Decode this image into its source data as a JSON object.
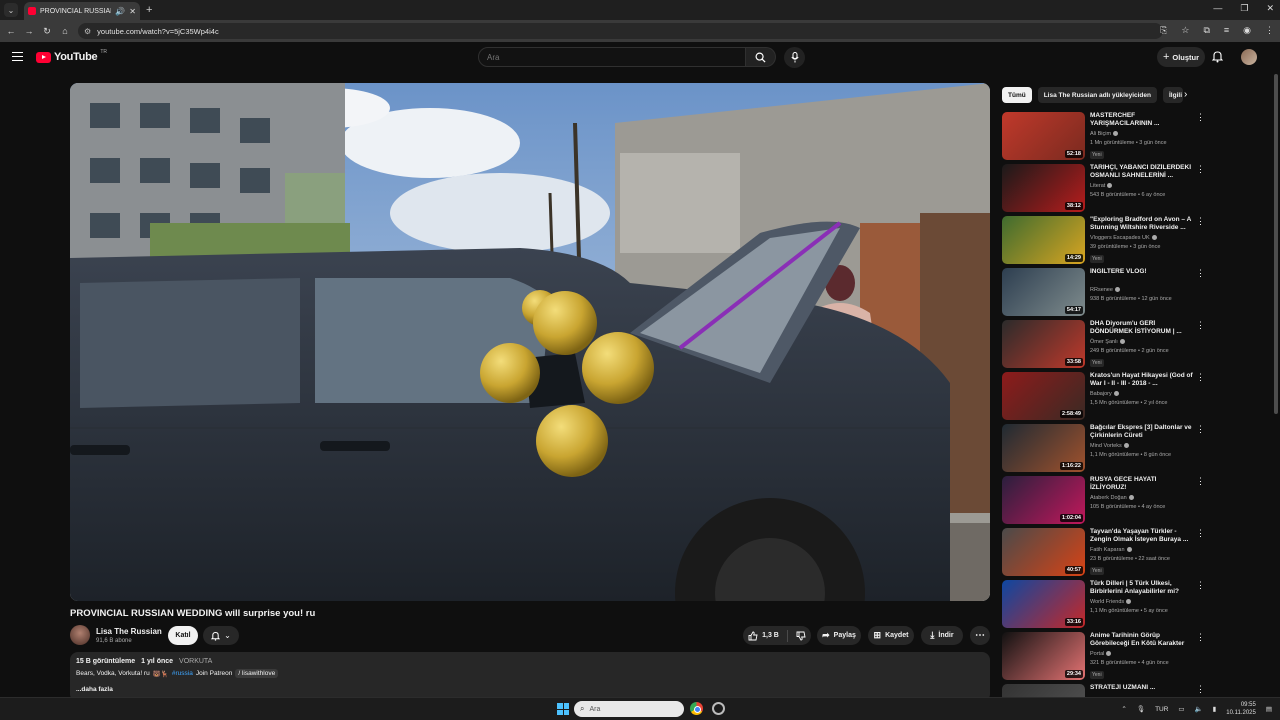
{
  "browser": {
    "tab_title": "PROVINCIAL RUSSIAN WEDDING...",
    "url": "youtube.com/watch?v=5jC35Wp4i4c"
  },
  "header": {
    "logo_text": "YouTube",
    "country_code": "TR",
    "search_placeholder": "Ara",
    "create_label": "Oluştur"
  },
  "video": {
    "title": "PROVINCIAL RUSSIAN WEDDING will surprise you! ru",
    "channel": "Lisa The Russian",
    "subscribers": "91,6 B abone",
    "join_label": "Katıl",
    "likes": "1,3 B",
    "share_label": "Paylaş",
    "save_label": "Kaydet",
    "download_label": "İndir"
  },
  "description": {
    "views": "15 B görüntüleme",
    "age": "1 yıl önce",
    "tag": "VORKUTA",
    "text": "Bears, Vodka, Vorkuta! ru",
    "hashtag": "#russia",
    "patreon": "Join Patreon",
    "link": "/ lisawithlove",
    "more": "...daha fazla"
  },
  "chips": [
    "Tümü",
    "Lisa The Russian adlı yükleyiciden",
    "İlgili"
  ],
  "recommendations": [
    {
      "title": "MASTERCHEF YARIŞMACILARININ ...",
      "channel": "Ali Biçim",
      "meta": "1 Mn görüntüleme • 3 gün önce",
      "duration": "52:18",
      "badge": "Yeni",
      "colors": [
        "#c0392b",
        "#7a2a1f"
      ]
    },
    {
      "title": "TARİHÇİ, YABANCI DİZİLERDEKİ OSMANLI SAHNELERİNİ ...",
      "channel": "Literat",
      "meta": "543 B görüntüleme • 6 ay önce",
      "duration": "38:12",
      "badge": "",
      "colors": [
        "#1a1a1a",
        "#b71c1c"
      ]
    },
    {
      "title": "\"Exploring Bradford on Avon – A Stunning Wiltshire Riverside ...",
      "channel": "Vloggers Escapades UK",
      "meta": "39 görüntüleme • 3 gün önce",
      "duration": "14:29",
      "badge": "Yeni",
      "colors": [
        "#3e6b2f",
        "#d9a521"
      ]
    },
    {
      "title": "İNGİLTERE VLOG!",
      "channel": "RRsenee",
      "meta": "938 B görüntüleme • 12 gün önce",
      "duration": "54:17",
      "badge": "",
      "colors": [
        "#2d3e50",
        "#7f8c8d"
      ]
    },
    {
      "title": "DHA Diyorum'u GERİ DÖNDÜRMEK İSTİYORUM | ...",
      "channel": "Ömer Şanlı",
      "meta": "249 B görüntüleme • 2 gün önce",
      "duration": "33:58",
      "badge": "Yeni",
      "colors": [
        "#2b2b2b",
        "#c0392b"
      ]
    },
    {
      "title": "Kratos'un Hayat Hikayesi (God of War I - II - III - 2018 - ...",
      "channel": "Babajory",
      "meta": "1,5 Mn görüntüleme • 2 yıl önce",
      "duration": "2:58:49",
      "badge": "",
      "colors": [
        "#8e1b1b",
        "#3a2a24"
      ]
    },
    {
      "title": "Bağcılar Ekspres [3] Daltonlar ve Çirkinlerin Cüreti",
      "channel": "Mind Vorteks",
      "meta": "1,1 Mn görüntüleme • 8 gün önce",
      "duration": "1:16:22",
      "badge": "",
      "colors": [
        "#1f2a33",
        "#a0522d"
      ]
    },
    {
      "title": "RUSYA GECE HAYATI İZLİYORUZ!",
      "channel": "Ataberk Doğan",
      "meta": "105 B görüntüleme • 4 ay önce",
      "duration": "1:02:04",
      "badge": "",
      "colors": [
        "#2a1f3d",
        "#c2185b"
      ]
    },
    {
      "title": "Tayvan'da Yaşayan Türkler - Zengin Olmak İsteyen Buraya ...",
      "channel": "Fatih Kaparan",
      "meta": "23 B görüntüleme • 22 saat önce",
      "duration": "40:57",
      "badge": "Yeni",
      "colors": [
        "#4a4a4a",
        "#d84315"
      ]
    },
    {
      "title": "Türk Dilleri | 5 Türk Ülkesi, Birbirlerini Anlayabilirler mi?",
      "channel": "World Friends",
      "meta": "1,1 Mn görüntüleme • 5 ay önce",
      "duration": "33:16",
      "badge": "",
      "colors": [
        "#0d47a1",
        "#c62828"
      ]
    },
    {
      "title": "Anime Tarihinin Görüp Görebileceği En Kötü Karakter",
      "channel": "Portal",
      "meta": "321 B görüntüleme • 4 gün önce",
      "duration": "29:34",
      "badge": "Yeni",
      "colors": [
        "#111111",
        "#e57373"
      ]
    },
    {
      "title": "STRATEJİ UZMANI ...",
      "channel": "",
      "meta": "",
      "duration": "",
      "badge": "",
      "colors": [
        "#333333",
        "#555555"
      ]
    }
  ],
  "taskbar": {
    "search_placeholder": "Ara",
    "lang": "TUR",
    "time": "09:55",
    "date": "10.11.2025"
  }
}
